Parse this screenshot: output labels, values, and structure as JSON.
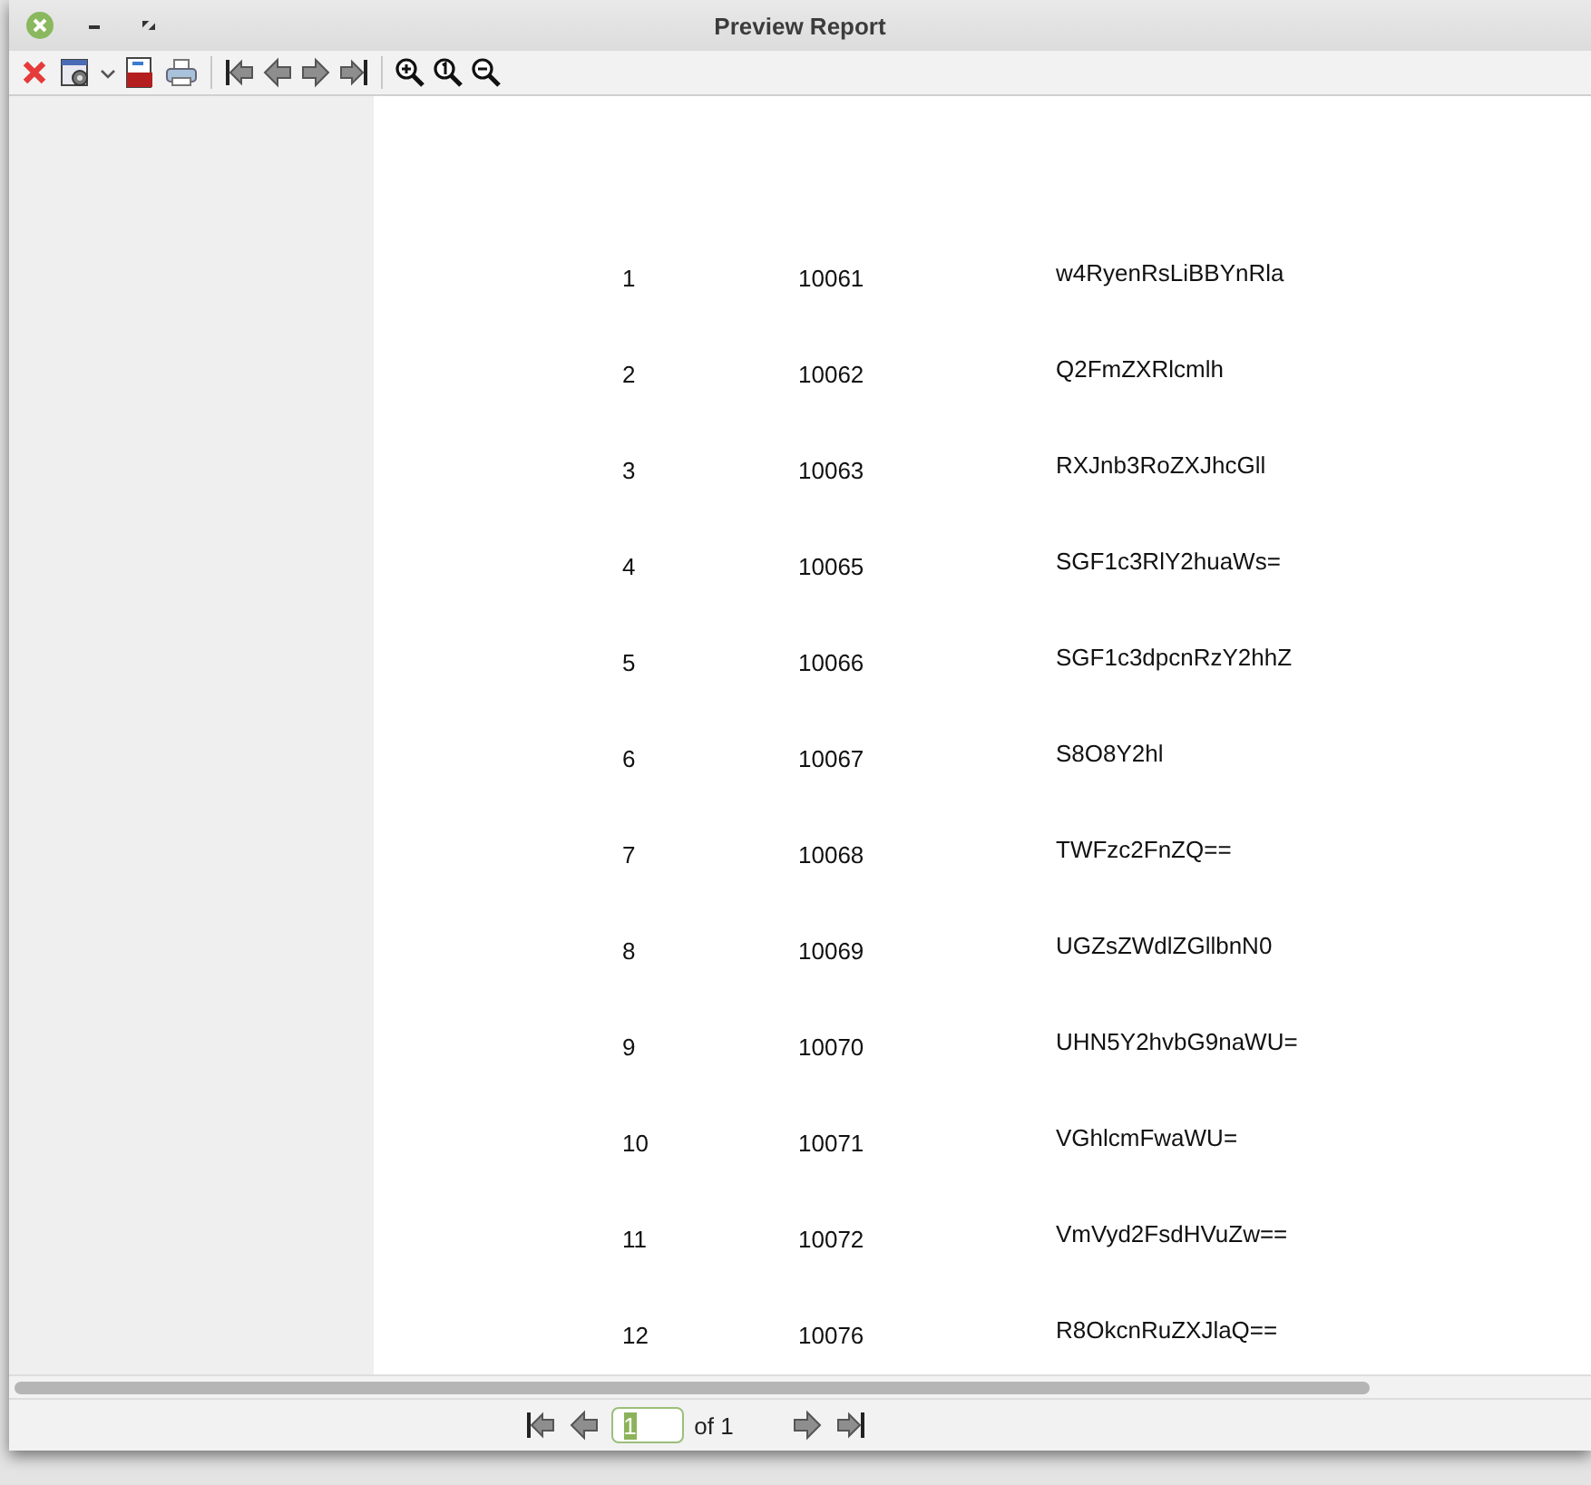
{
  "window": {
    "title": "Preview Report"
  },
  "rows": [
    {
      "no": "1",
      "id": "10061",
      "code": "w4RyenRsLiBBYnRla"
    },
    {
      "no": "2",
      "id": "10062",
      "code": "Q2FmZXRlcmlh"
    },
    {
      "no": "3",
      "id": "10063",
      "code": "RXJnb3RoZXJhcGll"
    },
    {
      "no": "4",
      "id": "10065",
      "code": "SGF1c3RlY2huaWs="
    },
    {
      "no": "5",
      "id": "10066",
      "code": "SGF1c3dpcnRzY2hhZ"
    },
    {
      "no": "6",
      "id": "10067",
      "code": "S8O8Y2hl"
    },
    {
      "no": "7",
      "id": "10068",
      "code": "TWFzc2FnZQ=="
    },
    {
      "no": "8",
      "id": "10069",
      "code": "UGZsZWdlZGllbnN0"
    },
    {
      "no": "9",
      "id": "10070",
      "code": "UHN5Y2hvbG9naWU="
    },
    {
      "no": "10",
      "id": "10071",
      "code": "VGhlcmFwaWU="
    },
    {
      "no": "11",
      "id": "10072",
      "code": "VmVyd2FsdHVuZw=="
    },
    {
      "no": "12",
      "id": "10076",
      "code": "R8OkcnRuZXJlaQ=="
    }
  ],
  "pager": {
    "page": "1",
    "of": "of 1"
  }
}
